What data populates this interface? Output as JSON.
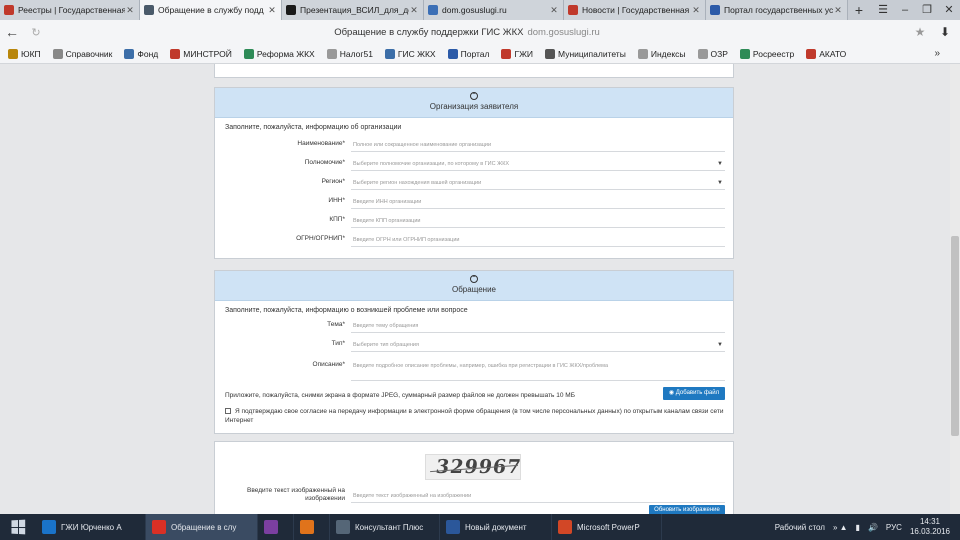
{
  "tabs": [
    {
      "title": "Реестры | Государственная ж",
      "color": "#c0392b",
      "active": false
    },
    {
      "title": "Обращение в службу подд",
      "color": "#4a5a6a",
      "active": true
    },
    {
      "title": "Презентация_ВСИЛ_для_докла",
      "color": "#1a1a1a",
      "active": false
    },
    {
      "title": "dom.gosuslugi.ru",
      "color": "#3b6fb6",
      "active": false
    },
    {
      "title": "Новости | Государственная ж",
      "color": "#c0392b",
      "active": false
    },
    {
      "title": "Портал государственных услу",
      "color": "#2b5aa8",
      "active": false
    }
  ],
  "address": {
    "title": "Обращение в службу поддержки ГИС ЖКХ",
    "domain": "dom.gosuslugi.ru"
  },
  "bookmarks": [
    {
      "label": "ЮКП",
      "color": "#b8860b"
    },
    {
      "label": "Справочник",
      "color": "#888888"
    },
    {
      "label": "Фонд",
      "color": "#3c6ea8"
    },
    {
      "label": "МИНСТРОЙ",
      "color": "#c0392b"
    },
    {
      "label": "Реформа ЖКХ",
      "color": "#2e8b57"
    },
    {
      "label": "Налог51",
      "color": "#999999"
    },
    {
      "label": "ГИС ЖКХ",
      "color": "#3c6ea8"
    },
    {
      "label": "Портал",
      "color": "#2b5aa8"
    },
    {
      "label": "ГЖИ",
      "color": "#c0392b"
    },
    {
      "label": "Муниципалитеты",
      "color": "#555555"
    },
    {
      "label": "Индексы",
      "color": "#999999"
    },
    {
      "label": "ОЗР",
      "color": "#999999"
    },
    {
      "label": "Росреестр",
      "color": "#2e8b57"
    },
    {
      "label": "АКАТО",
      "color": "#c0392b"
    }
  ],
  "organization": {
    "heading": "Организация заявителя",
    "hint": "Заполните, пожалуйста, информацию об организации",
    "fields": [
      {
        "label": "Наименование",
        "placeholder": "Полное или сокращенное наименование организации",
        "select": false
      },
      {
        "label": "Полномочие",
        "placeholder": "Выберите полномочие организации, по которому в ГИС ЖКХ",
        "select": true
      },
      {
        "label": "Регион",
        "placeholder": "Выберите регион нахождения вашей организации",
        "select": true
      },
      {
        "label": "ИНН",
        "placeholder": "Введите ИНН организации",
        "select": false
      },
      {
        "label": "КПП",
        "placeholder": "Введите КПП организации",
        "select": false
      },
      {
        "label": "ОГРН/ОГРНИП",
        "placeholder": "Введите ОГРН или ОГРНИП организации",
        "select": false
      }
    ]
  },
  "appeal": {
    "heading": "Обращение",
    "hint": "Заполните, пожалуйста, информацию о возникшей проблеме или вопросе",
    "fields": [
      {
        "label": "Тема",
        "placeholder": "Введите тему обращения",
        "select": false
      },
      {
        "label": "Тип",
        "placeholder": "Выберите тип обращения",
        "select": true
      }
    ],
    "description_label": "Описание",
    "description_placeholder": "Введите подробное описание проблемы, например, ошибка при регистрации в ГИС ЖКХ/проблема",
    "attach_note": "Приложите, пожалуйста, снимки экрана в формате JPEG, суммарный размер файлов не должен превышать 10 МБ",
    "attach_button": "Добавить файл",
    "consent": "Я подтверждаю свое согласие на передачу информации в электронной форме обращения (в том числе персональных данных) по открытым каналам связи сети Интернет"
  },
  "captcha": {
    "code": "329967",
    "label": "Введите текст изображенный на изображении",
    "placeholder": "Введите текст изображенный на изображении",
    "submit": "Обновить изображение"
  },
  "taskbar": {
    "items": [
      {
        "label": "ГЖИ Юрченко А",
        "color": "#1a73c9",
        "active": false
      },
      {
        "label": "Обращение в слу",
        "color": "#d93025",
        "active": true
      },
      {
        "label": "",
        "color": "#7b3fa0",
        "active": false
      },
      {
        "label": "",
        "color": "#e0731b",
        "active": false
      },
      {
        "label": "Консультант Плюс",
        "color": "#556677",
        "active": false
      },
      {
        "label": "Новый документ",
        "color": "#2b579a",
        "active": false
      },
      {
        "label": "Microsoft PowerP",
        "color": "#d24726",
        "active": false
      }
    ],
    "desktop_label": "Рабочий стол",
    "lang": "РУС",
    "time": "14:31",
    "date": "16.03.2016"
  }
}
